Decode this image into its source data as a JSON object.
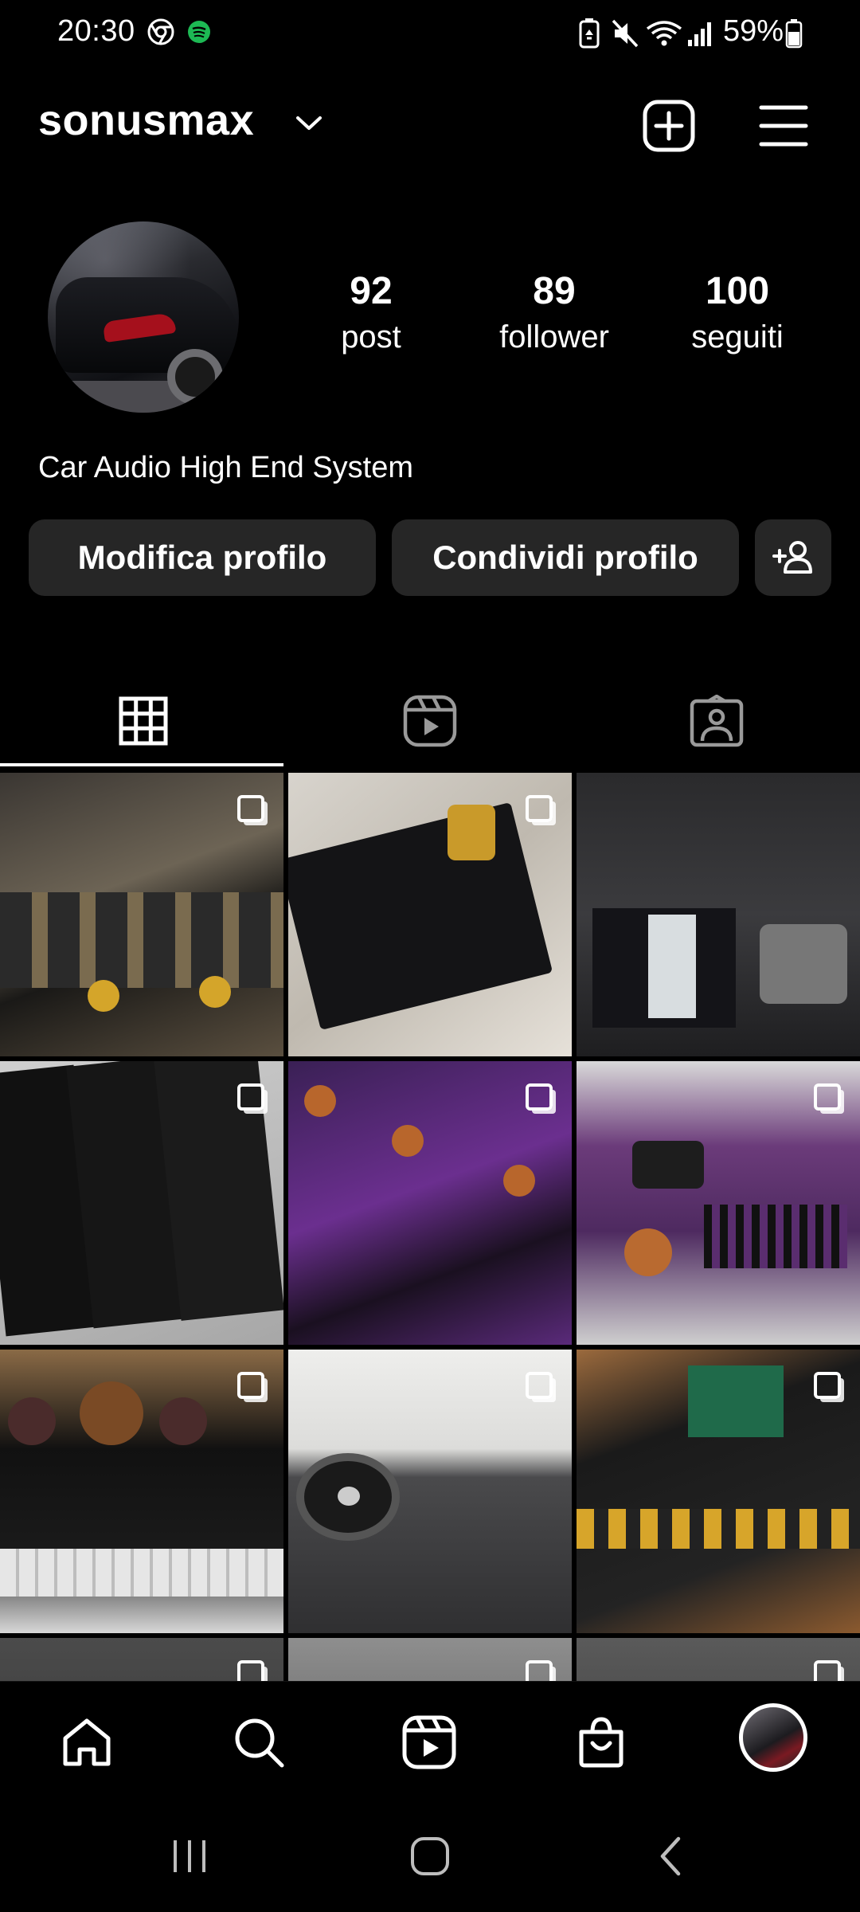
{
  "status_bar": {
    "time": "20:30",
    "battery_percent": "59%",
    "left_icons": [
      "chrome-icon",
      "spotify-icon"
    ],
    "right_icons": [
      "battery-saver-icon",
      "mute-icon",
      "wifi-icon",
      "signal-icon",
      "battery-icon"
    ]
  },
  "header": {
    "username": "sonusmax",
    "dropdown_icon": "chevron-down-icon",
    "actions": [
      "add-post-icon",
      "menu-icon"
    ]
  },
  "profile": {
    "stats": [
      {
        "value": "92",
        "label": "post"
      },
      {
        "value": "89",
        "label": "follower"
      },
      {
        "value": "100",
        "label": "seguiti"
      }
    ],
    "bio": "Car Audio High End System",
    "buttons": {
      "edit": "Modifica profilo",
      "share": "Condividi profilo",
      "discover_icon": "add-person-icon"
    }
  },
  "tabs": [
    {
      "name": "posts-grid",
      "icon": "grid-icon",
      "selected": true
    },
    {
      "name": "reels",
      "icon": "reels-icon",
      "selected": false
    },
    {
      "name": "tagged",
      "icon": "tagged-icon",
      "selected": false
    }
  ],
  "grid_posts": [
    {
      "description": "gold-amplifier-boards",
      "multi": true
    },
    {
      "description": "digital-converter-board",
      "multi": true
    },
    {
      "description": "installed-amplifier-trunk",
      "multi": false
    },
    {
      "description": "black-amplifiers-three",
      "multi": true
    },
    {
      "description": "purple-pcb-amplifiers",
      "multi": true
    },
    {
      "description": "purple-pcb-capacitors",
      "multi": true
    },
    {
      "description": "power-block-capacitors",
      "multi": true
    },
    {
      "description": "speaker-door-panel",
      "multi": true
    },
    {
      "description": "dsp-board-rca",
      "multi": true
    },
    {
      "description": "partial-row",
      "multi": true
    },
    {
      "description": "partial-row",
      "multi": true
    },
    {
      "description": "partial-row",
      "multi": true
    }
  ],
  "bottom_nav": [
    "home-icon",
    "search-icon",
    "reels-icon",
    "shop-icon",
    "profile-avatar"
  ],
  "system_nav": [
    "recents-icon",
    "home-button-icon",
    "back-icon"
  ]
}
